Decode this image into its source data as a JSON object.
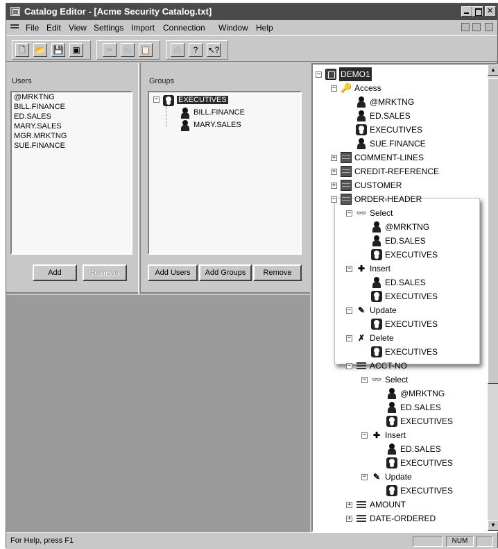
{
  "window": {
    "title": "Catalog Editor - [Acme Security Catalog.txt]"
  },
  "menu": [
    "File",
    "Edit",
    "View",
    "Settings",
    "Import",
    "Connection",
    "Window",
    "Help"
  ],
  "toolbar": {
    "tools": [
      {
        "icon": "new-icon",
        "glyph": "🗋"
      },
      {
        "icon": "open-icon",
        "glyph": "📂"
      },
      {
        "icon": "save-icon",
        "glyph": "💾"
      },
      {
        "icon": "save-all-icon",
        "glyph": "▣"
      },
      {
        "icon": "cut-icon",
        "glyph": "✂"
      },
      {
        "icon": "copy-icon",
        "glyph": "⎘"
      },
      {
        "icon": "paste-icon",
        "glyph": "📋"
      },
      {
        "icon": "print-icon",
        "glyph": "⎙"
      },
      {
        "icon": "help-icon",
        "glyph": "?"
      },
      {
        "icon": "context-help-icon",
        "glyph": "↖?"
      }
    ]
  },
  "users": {
    "header": "Users",
    "items": [
      "@MRKTNG",
      "BILL.FINANCE",
      "ED.SALES",
      "MARY.SALES",
      "MGR.MRKTNG",
      "SUE.FINANCE"
    ],
    "add_label": "Add",
    "remove_label": "Remove"
  },
  "groups": {
    "header": "Groups",
    "group_name": "EXECUTIVES",
    "members": [
      "BILL.FINANCE",
      "MARY.SALES"
    ],
    "add_users_label": "Add Users",
    "add_groups_label": "Add Groups",
    "remove_label": "Remove"
  },
  "tree": {
    "rows": [
      {
        "label": "DEMO1",
        "level": 0,
        "icon": "db",
        "toggle": "-",
        "selected": true
      },
      {
        "label": "Access",
        "level": 1,
        "icon": "key",
        "toggle": "-"
      },
      {
        "label": "@MRKTNG",
        "level": 2,
        "icon": "person"
      },
      {
        "label": "ED.SALES",
        "level": 2,
        "icon": "person"
      },
      {
        "label": "EXECUTIVES",
        "level": 2,
        "icon": "group"
      },
      {
        "label": "SUE.FINANCE",
        "level": 2,
        "icon": "person"
      },
      {
        "label": "COMMENT-LINES",
        "level": 1,
        "icon": "table",
        "toggle": "+"
      },
      {
        "label": "CREDIT-REFERENCE",
        "level": 1,
        "icon": "table",
        "toggle": "+"
      },
      {
        "label": "CUSTOMER",
        "level": 1,
        "icon": "table",
        "toggle": "+"
      },
      {
        "label": "ORDER-HEADER",
        "level": 1,
        "icon": "table",
        "toggle": "-"
      },
      {
        "label": "Select",
        "level": 2,
        "icon": "binoculars",
        "toggle": "-"
      },
      {
        "label": "@MRKTNG",
        "level": 3,
        "icon": "person"
      },
      {
        "label": "ED.SALES",
        "level": 3,
        "icon": "person"
      },
      {
        "label": "EXECUTIVES",
        "level": 3,
        "icon": "group"
      },
      {
        "label": "Insert",
        "level": 2,
        "icon": "insert",
        "toggle": "-"
      },
      {
        "label": "ED.SALES",
        "level": 3,
        "icon": "person"
      },
      {
        "label": "EXECUTIVES",
        "level": 3,
        "icon": "group"
      },
      {
        "label": "Update",
        "level": 2,
        "icon": "pencil",
        "toggle": "-"
      },
      {
        "label": "EXECUTIVES",
        "level": 3,
        "icon": "group"
      },
      {
        "label": "Delete",
        "level": 2,
        "icon": "delete",
        "toggle": "-"
      },
      {
        "label": "EXECUTIVES",
        "level": 3,
        "icon": "group"
      },
      {
        "label": "ACCT-NO",
        "level": 2,
        "icon": "column",
        "toggle": "-"
      },
      {
        "label": "Select",
        "level": 3,
        "icon": "binoculars",
        "toggle": "-"
      },
      {
        "label": "@MRKTNG",
        "level": 4,
        "icon": "person"
      },
      {
        "label": "ED.SALES",
        "level": 4,
        "icon": "person"
      },
      {
        "label": "EXECUTIVES",
        "level": 4,
        "icon": "group"
      },
      {
        "label": "Insert",
        "level": 3,
        "icon": "insert",
        "toggle": "-"
      },
      {
        "label": "ED.SALES",
        "level": 4,
        "icon": "person"
      },
      {
        "label": "EXECUTIVES",
        "level": 4,
        "icon": "group"
      },
      {
        "label": "Update",
        "level": 3,
        "icon": "pencil",
        "toggle": "-"
      },
      {
        "label": "EXECUTIVES",
        "level": 4,
        "icon": "group"
      },
      {
        "label": "AMOUNT",
        "level": 2,
        "icon": "column",
        "toggle": "+"
      },
      {
        "label": "DATE-ORDERED",
        "level": 2,
        "icon": "column",
        "toggle": "+"
      }
    ]
  },
  "status": {
    "text": "For Help, press F1",
    "num": "NUM"
  }
}
